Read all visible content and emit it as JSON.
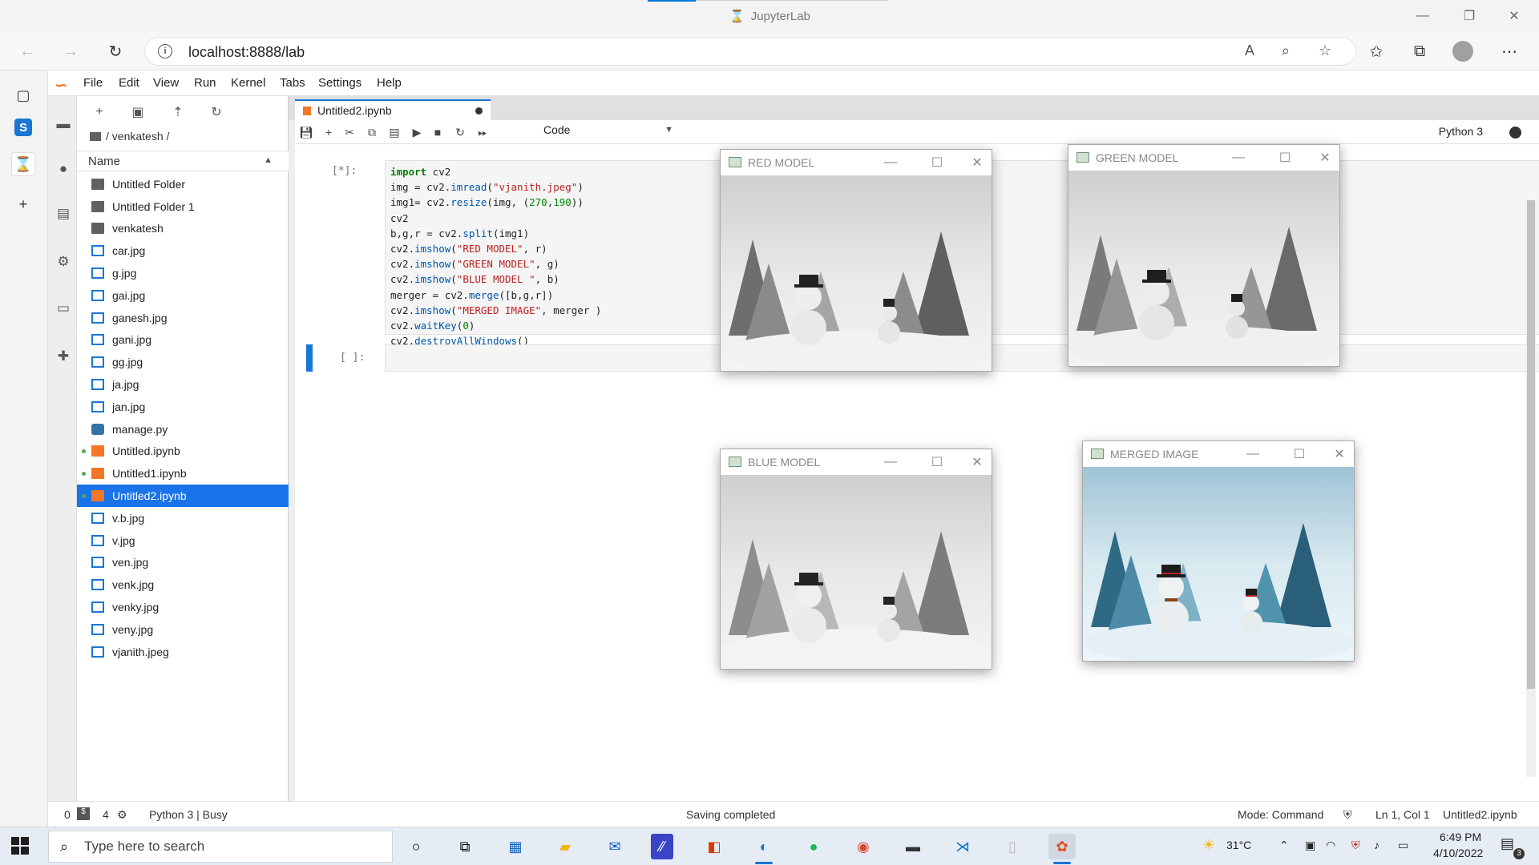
{
  "browser": {
    "window_title": "JupyterLab",
    "url": "localhost:8888/lab"
  },
  "jupyter": {
    "menu": [
      "File",
      "Edit",
      "View",
      "Run",
      "Kernel",
      "Tabs",
      "Settings",
      "Help"
    ],
    "breadcrumb": "/ venkatesh /",
    "file_header": "Name",
    "files": [
      {
        "name": "Untitled Folder",
        "type": "folder"
      },
      {
        "name": "Untitled Folder 1",
        "type": "folder"
      },
      {
        "name": "venkatesh",
        "type": "folder"
      },
      {
        "name": "car.jpg",
        "type": "image"
      },
      {
        "name": "g.jpg",
        "type": "image"
      },
      {
        "name": "gai.jpg",
        "type": "image"
      },
      {
        "name": "ganesh.jpg",
        "type": "image"
      },
      {
        "name": "gani.jpg",
        "type": "image"
      },
      {
        "name": "gg.jpg",
        "type": "image"
      },
      {
        "name": "ja.jpg",
        "type": "image"
      },
      {
        "name": "jan.jpg",
        "type": "image"
      },
      {
        "name": "manage.py",
        "type": "python"
      },
      {
        "name": "Untitled.ipynb",
        "type": "notebook",
        "running": true
      },
      {
        "name": "Untitled1.ipynb",
        "type": "notebook",
        "running": true
      },
      {
        "name": "Untitled2.ipynb",
        "type": "notebook",
        "running": true,
        "selected": true
      },
      {
        "name": "v.b.jpg",
        "type": "image"
      },
      {
        "name": "v.jpg",
        "type": "image"
      },
      {
        "name": "ven.jpg",
        "type": "image"
      },
      {
        "name": "venk.jpg",
        "type": "image"
      },
      {
        "name": "venky.jpg",
        "type": "image"
      },
      {
        "name": "veny.jpg",
        "type": "image"
      },
      {
        "name": "vjanith.jpeg",
        "type": "image"
      }
    ],
    "tab_title": "Untitled2.ipynb",
    "cell_type": "Code",
    "kernel_name": "Python 3",
    "cells": [
      {
        "prompt": "[*]:"
      },
      {
        "prompt": "[ ]:"
      }
    ],
    "status": {
      "terminals": "0",
      "kernels": "4",
      "kernel_state": "Python 3 | Busy",
      "message": "Saving completed",
      "mode": "Mode: Command",
      "cursor": "Ln 1, Col 1",
      "file": "Untitled2.ipynb"
    }
  },
  "code_lines": [
    "import cv2",
    "img = cv2.imread(\"vjanith.jpeg\")",
    "img1= cv2.resize(img, (270,190))",
    "cv2",
    "b,g,r = cv2.split(img1)",
    "cv2.imshow(\"RED MODEL\", r)",
    "cv2.imshow(\"GREEN MODEL\", g)",
    "cv2.imshow(\"BLUE MODEL \", b)",
    "merger = cv2.merge([b,g,r])",
    "cv2.imshow(\"MERGED IMAGE\", merger )",
    "cv2.waitKey(0)",
    "cv2.destroyAllWindows()"
  ],
  "cv_windows": {
    "red": "RED MODEL",
    "green": "GREEN MODEL",
    "blue": "BLUE MODEL",
    "merged": "MERGED IMAGE"
  },
  "taskbar": {
    "search_placeholder": "Type here to search",
    "temperature": "31°C",
    "time": "6:49 PM",
    "date": "4/10/2022",
    "notifications": "3"
  },
  "colors": {
    "jupyter_orange": "#f37726",
    "selection_blue": "#1a73e8"
  }
}
